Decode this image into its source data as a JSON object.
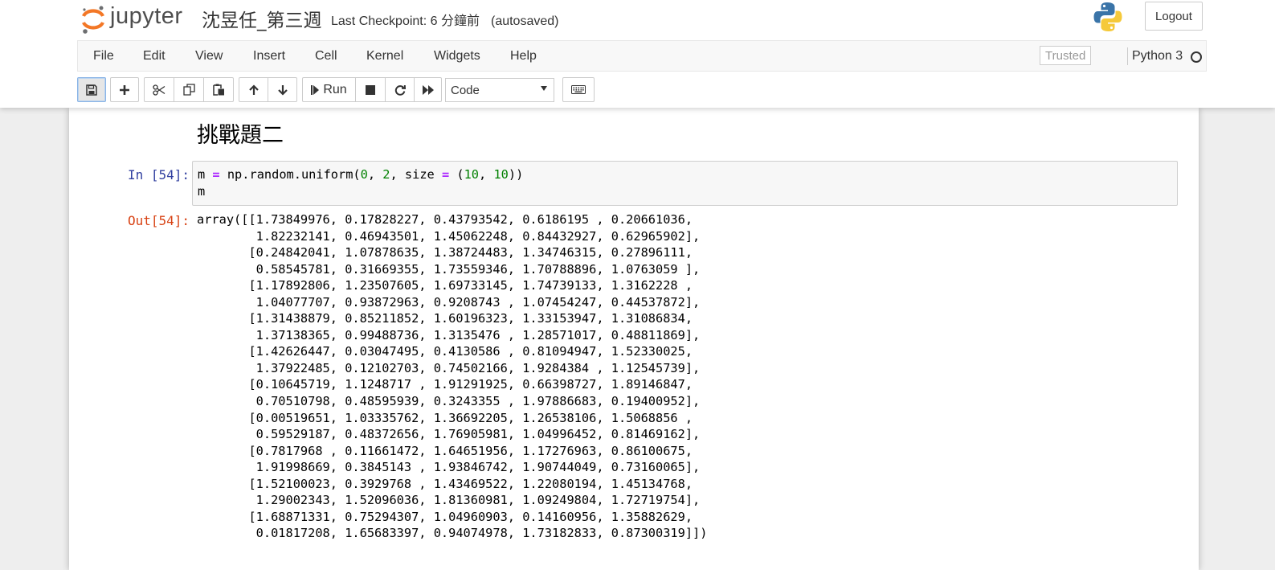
{
  "header": {
    "logo_text": "jupyter",
    "notebook_name": "沈昱任_第三週",
    "checkpoint_label": "Last Checkpoint: 6 分鐘前",
    "autosave_status": "(autosaved)",
    "logout_label": "Logout"
  },
  "menu": {
    "items": [
      "File",
      "Edit",
      "View",
      "Insert",
      "Cell",
      "Kernel",
      "Widgets",
      "Help"
    ],
    "trusted_label": "Trusted",
    "kernel_name": "Python 3"
  },
  "toolbar": {
    "run_label": "Run",
    "cell_type": "Code",
    "icons": [
      "save-icon",
      "plus-icon",
      "scissors-icon",
      "copy-icon",
      "paste-icon",
      "arrow-up-icon",
      "arrow-down-icon",
      "step-forward-icon",
      "stop-icon",
      "restart-icon",
      "fast-forward-icon",
      "keyboard-icon"
    ]
  },
  "notebook": {
    "heading": "挑戰題二",
    "cell": {
      "in_prompt": "In [54]:",
      "out_prompt": "Out[54]:",
      "code_line_1": {
        "t1": "m ",
        "op1": "=",
        "t2": " np.random.uniform(",
        "n1": "0",
        "t3": ", ",
        "n2": "2",
        "t4": ", size ",
        "op2": "=",
        "t5": " (",
        "n3": "10",
        "t6": ", ",
        "n4": "10",
        "t7": "))"
      },
      "code_line_2": "m",
      "output_lines": [
        "array([[1.73849976, 0.17828227, 0.43793542, 0.6186195 , 0.20661036,",
        "        1.82232141, 0.46943501, 1.45062248, 0.84432927, 0.62965902],",
        "       [0.24842041, 1.07878635, 1.38724483, 1.34746315, 0.27896111,",
        "        0.58545781, 0.31669355, 1.73559346, 1.70788896, 1.0763059 ],",
        "       [1.17892806, 1.23507605, 1.69733145, 1.74739133, 1.3162228 ,",
        "        1.04077707, 0.93872963, 0.9208743 , 1.07454247, 0.44537872],",
        "       [1.31438879, 0.85211852, 1.60196323, 1.33153947, 1.31086834,",
        "        1.37138365, 0.99488736, 1.3135476 , 1.28571017, 0.48811869],",
        "       [1.42626447, 0.03047495, 0.4130586 , 0.81094947, 1.52330025,",
        "        1.37922485, 0.12102703, 0.74502166, 1.9284384 , 1.12545739],",
        "       [0.10645719, 1.1248717 , 1.91291925, 0.66398727, 1.89146847,",
        "        0.70510798, 0.48595939, 0.3243355 , 1.97886683, 0.19400952],",
        "       [0.00519651, 1.03335762, 1.36692205, 1.26538106, 1.5068856 ,",
        "        0.59529187, 0.48372656, 1.76905981, 1.04996452, 0.81469162],",
        "       [0.7817968 , 0.11661472, 1.64651956, 1.17276963, 0.86100675,",
        "        1.91998669, 0.3845143 , 1.93846742, 1.90744049, 0.73160065],",
        "       [1.52100023, 0.3929768 , 1.43469522, 1.22080194, 1.45134768,",
        "        1.29002343, 1.52096036, 1.81360981, 1.09249804, 1.72719754],",
        "       [1.68871331, 0.75294307, 1.04960903, 0.14160956, 1.35882629,",
        "        0.01817208, 1.65683397, 0.94074978, 1.73182833, 0.87300319]])"
      ]
    }
  },
  "colors": {
    "in_prompt": "#303f9f",
    "out_prompt": "#d84315",
    "keyword": "#aa22ff",
    "number": "#008000",
    "logo_orange": "#f37726"
  }
}
